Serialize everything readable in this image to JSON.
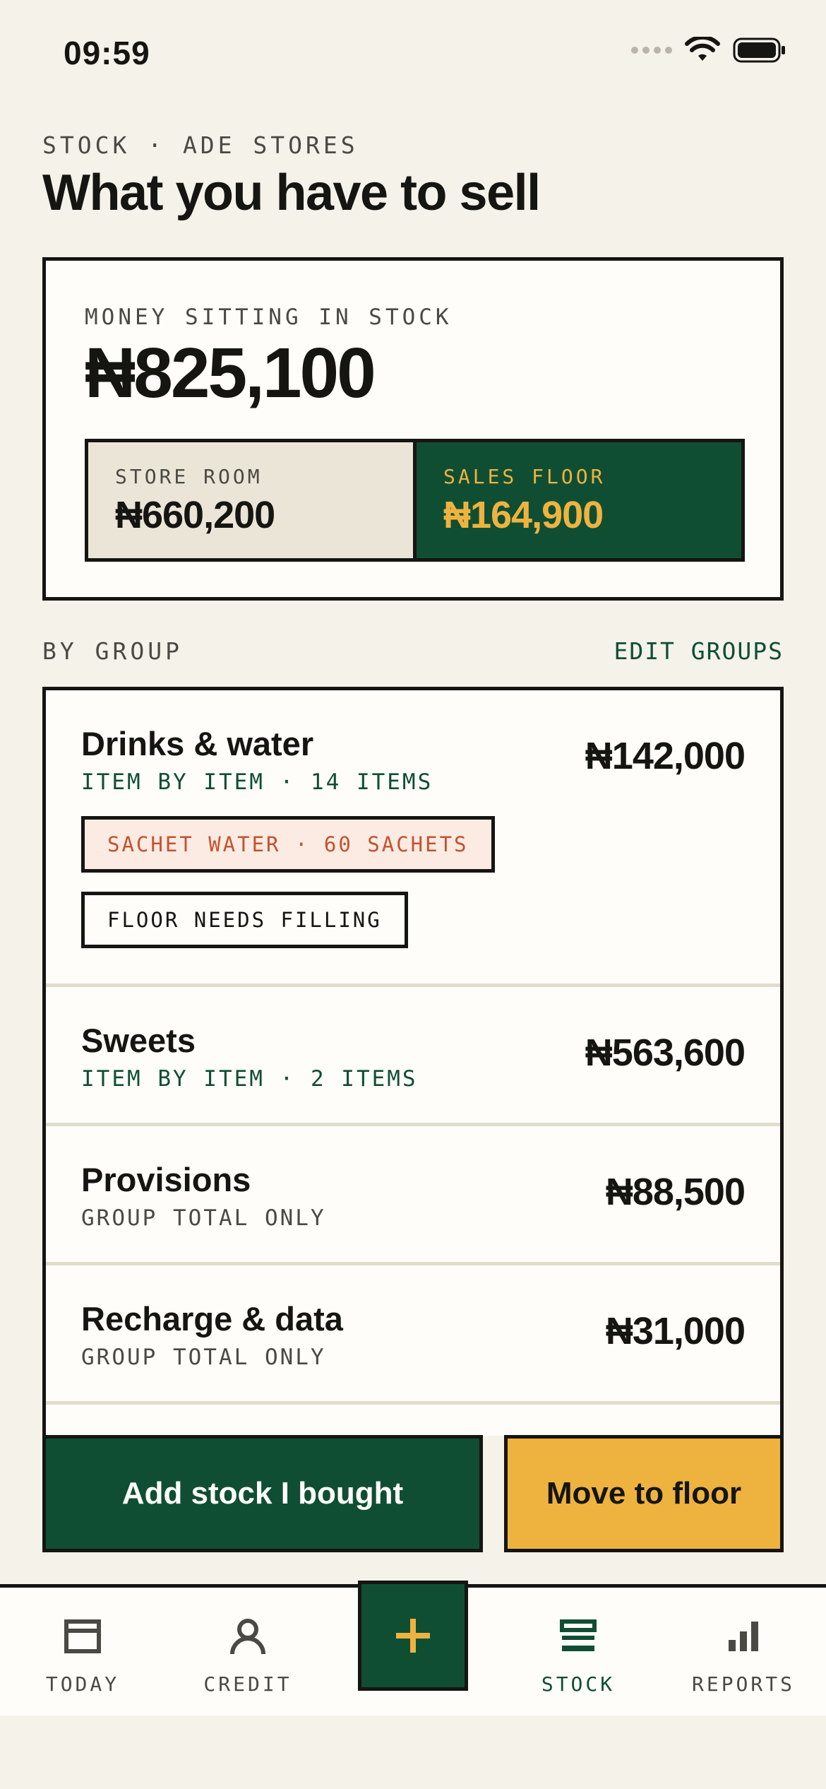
{
  "status_bar": {
    "time": "09:59"
  },
  "header": {
    "eyebrow": "STOCK · ADE STORES",
    "title": "What you have to sell"
  },
  "summary": {
    "label": "MONEY SITTING IN STOCK",
    "value": "₦825,100",
    "store_room": {
      "label": "STORE ROOM",
      "value": "₦660,200"
    },
    "sales_floor": {
      "label": "SALES FLOOR",
      "value": "₦164,900"
    }
  },
  "groups_section": {
    "label": "BY GROUP",
    "action": "EDIT GROUPS"
  },
  "groups": [
    {
      "name": "Drinks & water",
      "meta": "ITEM BY ITEM · 14 ITEMS",
      "value": "₦142,000",
      "chips": [
        "SACHET WATER · 60 SACHETS",
        "FLOOR NEEDS FILLING"
      ]
    },
    {
      "name": "Sweets",
      "meta": "ITEM BY ITEM · 2 ITEMS",
      "value": "₦563,600"
    },
    {
      "name": "Provisions",
      "meta": "GROUP TOTAL ONLY",
      "value": "₦88,500"
    },
    {
      "name": "Recharge & data",
      "meta": "GROUP TOTAL ONLY",
      "value": "₦31,000"
    }
  ],
  "actions": {
    "add_stock": "Add stock I bought",
    "move_to_floor": "Move to floor"
  },
  "nav": {
    "tabs": [
      {
        "label": "TODAY",
        "icon": "wallet-icon"
      },
      {
        "label": "CREDIT",
        "icon": "person-icon"
      },
      {
        "label": "STOCK",
        "icon": "stack-icon",
        "active": true
      },
      {
        "label": "REPORTS",
        "icon": "bar-chart-icon"
      }
    ],
    "fab_icon": "plus-icon"
  },
  "colors": {
    "green": "#104e33",
    "amber": "#eeb33f",
    "warn": "#c4522e",
    "ink": "#151512",
    "paper": "#f5f2ea"
  }
}
